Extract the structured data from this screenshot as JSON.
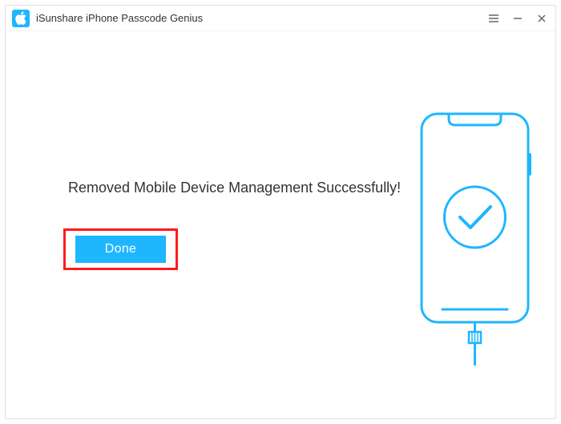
{
  "app": {
    "title": "iSunshare iPhone Passcode Genius"
  },
  "content": {
    "message": "Removed Mobile Device Management Successfully!",
    "done_label": "Done"
  },
  "colors": {
    "accent": "#1eb6ff",
    "highlight_border": "#ff1a1a"
  }
}
